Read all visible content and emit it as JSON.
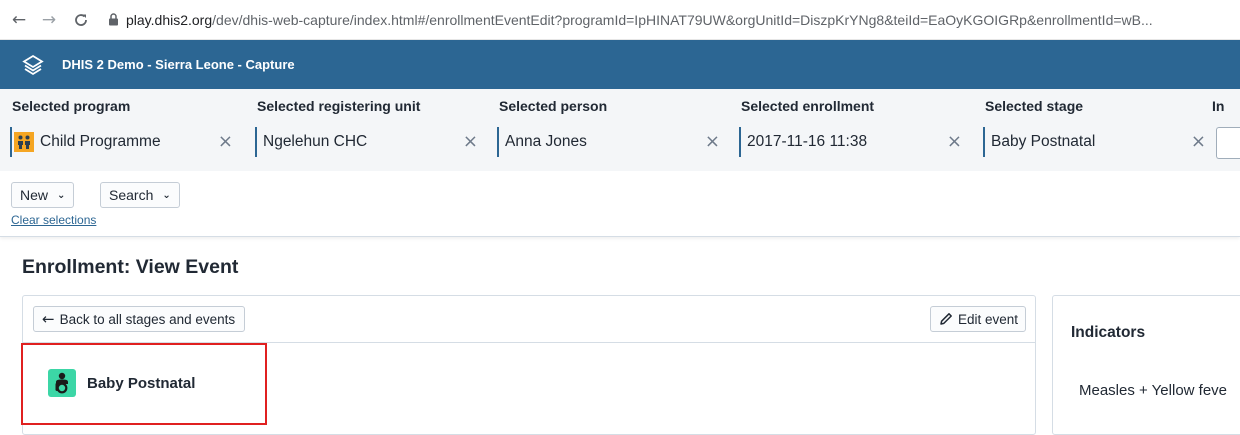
{
  "browser": {
    "url_host": "play.dhis2.org",
    "url_path": "/dev/dhis-web-capture/index.html#/enrollmentEventEdit?programId=IpHINAT79UW&orgUnitId=DiszpKrYNg8&teiId=EaOyKGOIGRp&enrollmentId=wB..."
  },
  "header": {
    "title": "DHIS 2 Demo - Sierra Leone - Capture"
  },
  "selection": {
    "items": [
      {
        "label": "Selected program",
        "value": "Child Programme",
        "icon": "child-programme-icon"
      },
      {
        "label": "Selected registering unit",
        "value": "Ngelehun CHC"
      },
      {
        "label": "Selected person",
        "value": "Anna Jones"
      },
      {
        "label": "Selected enrollment",
        "value": "2017-11-16 11:38"
      },
      {
        "label": "Selected stage",
        "value": "Baby Postnatal"
      },
      {
        "label": "In"
      }
    ],
    "clear_glyph": "×"
  },
  "quick_actions": {
    "new_label": "New",
    "search_label": "Search",
    "clear_label": "Clear selections"
  },
  "main": {
    "page_title": "Enrollment: View Event",
    "back_label": "Back to all stages and events",
    "edit_label": "Edit event",
    "stage_name": "Baby Postnatal",
    "stage_icon": "mother-child-icon",
    "stage_icon_color": "#3cd6a6"
  },
  "indicators": {
    "title": "Indicators",
    "items": [
      "Measles + Yellow feve"
    ]
  },
  "colors": {
    "header_bg": "#2c6693",
    "selection_bg": "#f4f6f8",
    "highlight": "#e02020",
    "program_icon_bg": "#f5a623"
  }
}
